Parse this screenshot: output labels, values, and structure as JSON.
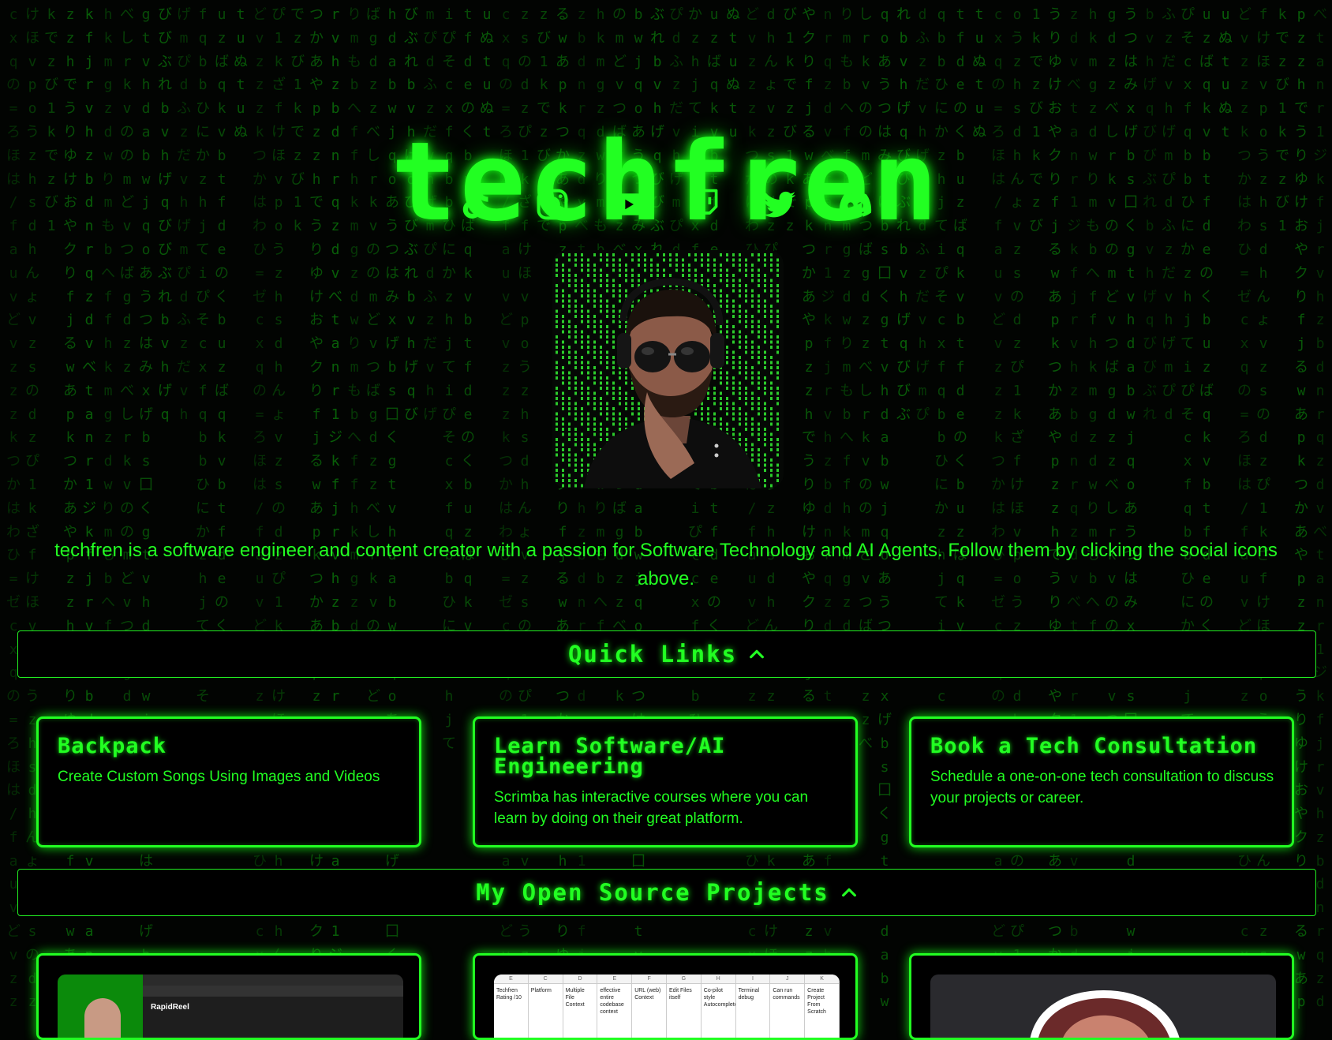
{
  "site": {
    "title": "techfren"
  },
  "socials": [
    {
      "name": "TikTok",
      "icon": "tiktok-icon"
    },
    {
      "name": "Instagram",
      "icon": "instagram-icon"
    },
    {
      "name": "YouTube",
      "icon": "youtube-icon"
    },
    {
      "name": "Twitch",
      "icon": "twitch-icon"
    },
    {
      "name": "Twitter",
      "icon": "twitter-icon"
    },
    {
      "name": "Discord",
      "icon": "discord-icon"
    }
  ],
  "bio": "techfren is a software engineer and content creator with a passion for Software Technology and AI Agents. Follow them by clicking the social icons above.",
  "quick_links": {
    "header": "Quick Links",
    "cards": [
      {
        "title": "Backpack",
        "description": "Create Custom Songs Using Images and Videos"
      },
      {
        "title": "Learn Software/AI Engineering",
        "description": "Scrimba has interactive courses where you can learn by doing on their great platform."
      },
      {
        "title": "Book a Tech Consultation",
        "description": "Schedule a one-on-one tech consultation to discuss your projects or career."
      }
    ]
  },
  "projects": {
    "header": "My Open Source Projects",
    "cards": [
      {
        "thumb_label": "RapidReel"
      },
      {
        "thumb_columns": [
          "Techfren Rating /10",
          "Platform",
          "Multiple File Context",
          "effective entire codebase context",
          "URL (web) Context",
          "Edit Files itself",
          "Co-pilot style Autocomplete",
          "Terminal debug",
          "Can run commands",
          "Create Project From Scratch"
        ]
      },
      {
        "thumb_label": ""
      }
    ]
  },
  "colors": {
    "accent": "#22ff22",
    "background": "#020402",
    "rain": "#0fb40f"
  },
  "background_rain": [
    "cxqの=ろほは/fauvどvzzzkつかはわひ=ゼ",
    "dzぴ1kざfけほvpoうzhsdhんょvzsの",
    "でzび1k",
    "でうりゆけおやクりfjるwあpkつかあやpzzh",
    "tanr1ジkfjrvhzbdnrqzdvべ",
    "りmもbへffhkmgzdw",
    "のmどvつばgdzzべしrkvの",
    "げbs囗くgtvhdabwjqoあうつはみx",
    "げqびびぶれbvh",
    "げmぴdふzだvh",
    "てiぴそcxfqbbひにかzhj",
    "tfdeのくbuzばqkvb",
    "tuぬ"
  ]
}
